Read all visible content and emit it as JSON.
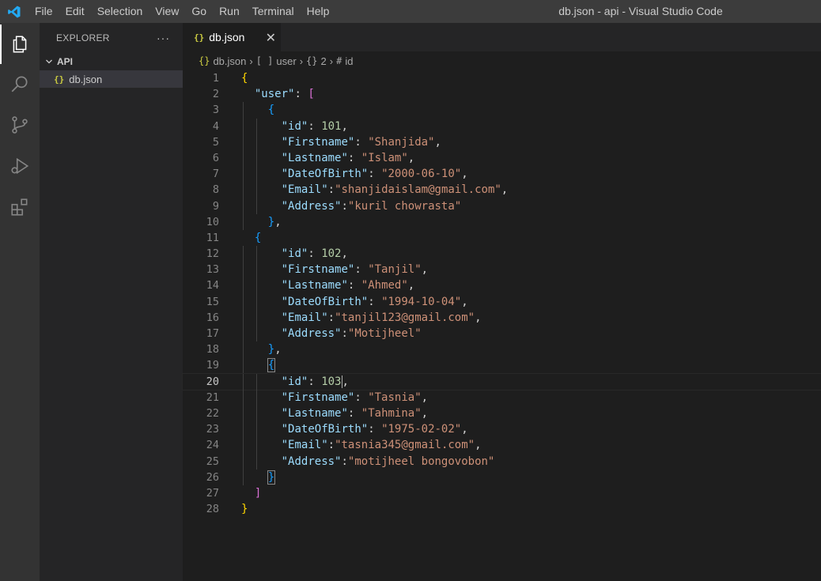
{
  "window": {
    "title": "db.json - api - Visual Studio Code"
  },
  "menu": [
    "File",
    "Edit",
    "Selection",
    "View",
    "Go",
    "Run",
    "Terminal",
    "Help"
  ],
  "activity_bar": [
    {
      "name": "explorer-icon"
    },
    {
      "name": "search-icon"
    },
    {
      "name": "source-control-icon"
    },
    {
      "name": "run-debug-icon"
    },
    {
      "name": "extensions-icon"
    }
  ],
  "sidebar": {
    "header": "EXPLORER",
    "more": "···",
    "folder": "API",
    "file": "db.json",
    "file_icon": "{}"
  },
  "editor": {
    "tab_label": "db.json",
    "tab_icon": "{}",
    "breadcrumbs": {
      "file": "db.json",
      "array_icon": "[ ]",
      "array": "user",
      "object_icon": "{}",
      "object": "2",
      "field_icon": "#",
      "field": "id"
    },
    "current_line": 20,
    "lines": [
      "1",
      "2",
      "3",
      "4",
      "5",
      "6",
      "7",
      "8",
      "9",
      "10",
      "11",
      "12",
      "13",
      "14",
      "15",
      "16",
      "17",
      "18",
      "19",
      "20",
      "21",
      "22",
      "23",
      "24",
      "25",
      "26",
      "27",
      "28"
    ]
  },
  "users": [
    {
      "id": "101",
      "Firstname": "\"Shanjida\"",
      "Lastname": "\"Islam\"",
      "DateOfBirth": "\"2000-06-10\"",
      "Email": "\"shanjidaislam@gmail.com\"",
      "Address": "\"kuril chowrasta\""
    },
    {
      "id": "102",
      "Firstname": "\"Tanjil\"",
      "Lastname": "\"Ahmed\"",
      "DateOfBirth": "\"1994-10-04\"",
      "Email": "\"tanjil123@gmail.com\"",
      "Address": "\"Motijheel\""
    },
    {
      "id": "103",
      "Firstname": "\"Tasnia\"",
      "Lastname": "\"Tahmina\"",
      "DateOfBirth": "\"1975-02-02\"",
      "Email": "\"tasnia345@gmail.com\"",
      "Address": "\"motijheel bongovobon\""
    }
  ],
  "keys": {
    "user": "\"user\"",
    "id": "\"id\"",
    "Firstname": "\"Firstname\"",
    "Lastname": "\"Lastname\"",
    "DateOfBirth": "\"DateOfBirth\"",
    "Email": "\"Email\"",
    "Address": "\"Address\""
  },
  "colors": {
    "string": "#ce9178",
    "number": "#b5cea8",
    "key": "#9cdcfe",
    "bracket_level1": "#ffd700",
    "bracket_level2": "#da70d6",
    "bracket_level3": "#179fff"
  }
}
